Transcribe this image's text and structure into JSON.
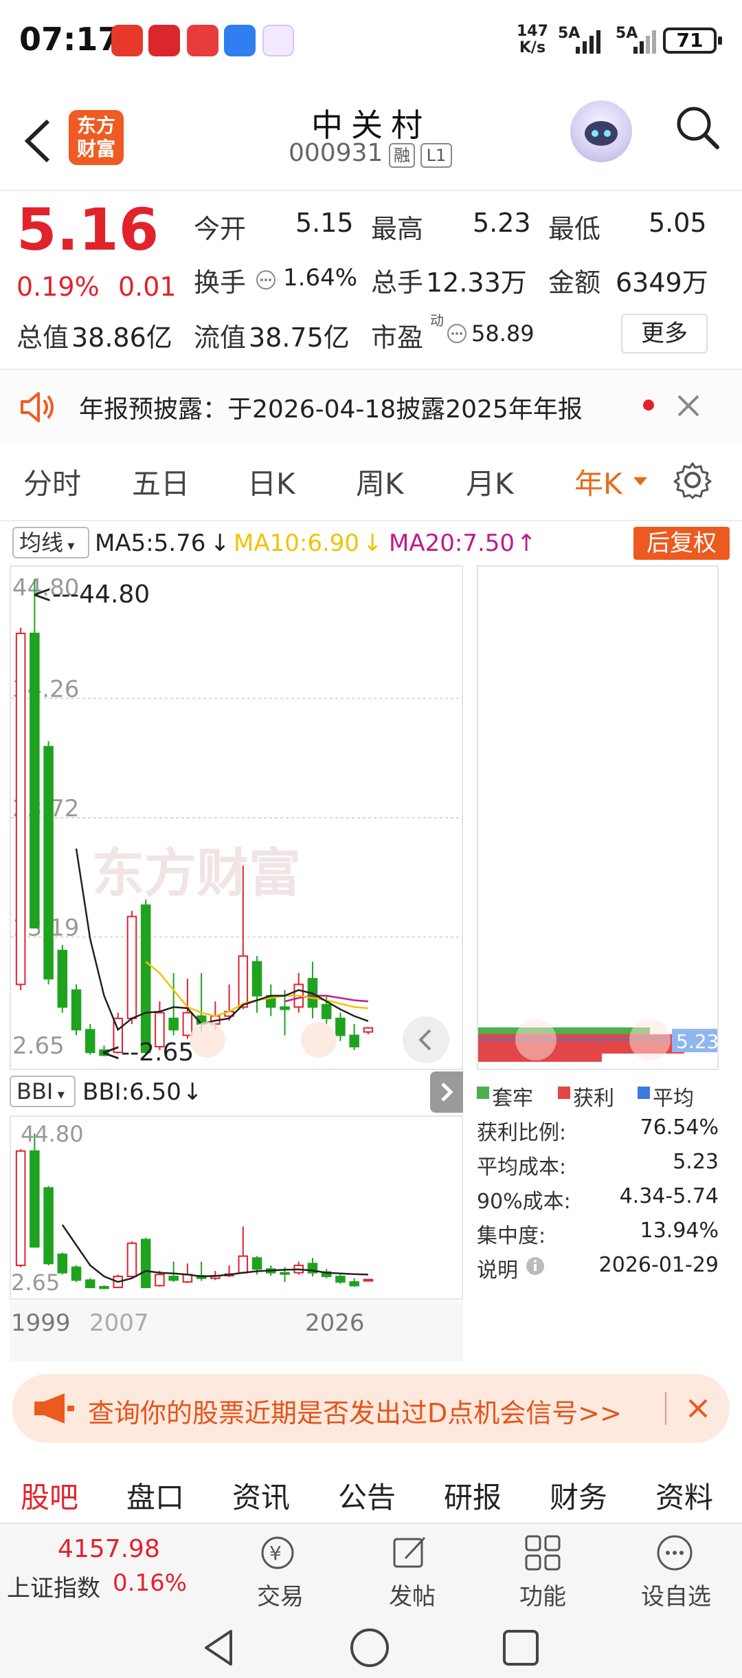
{
  "status_bar": {
    "time": "07:17",
    "net_speed_value": "147",
    "net_speed_unit": "K/s",
    "sig1": "5A",
    "sig2": "5A",
    "battery": "71"
  },
  "header": {
    "logo_text_line1": "东方",
    "logo_text_line2": "财富",
    "name": "中关村",
    "code": "000931",
    "tag1": "融",
    "tag2": "L1"
  },
  "quote": {
    "price": "5.16",
    "change_pct": "0.19%",
    "change": "0.01",
    "open_label": "今开",
    "open": "5.15",
    "high_label": "最高",
    "high": "5.23",
    "low_label": "最低",
    "low": "5.05",
    "turnover_label": "换手",
    "turnover": "1.64%",
    "volume_label": "总手",
    "volume": "12.33万",
    "amount_label": "金额",
    "amount": "6349万",
    "mktcap_label": "总值",
    "mktcap": "38.86亿",
    "float_label": "流值",
    "float": "38.75亿",
    "pe_label": "市盈",
    "pe_sup": "动",
    "pe": "58.89",
    "more": "更多"
  },
  "notice": {
    "text": "年报预披露：于2026-04-18披露2025年年报"
  },
  "period_tabs": [
    "分时",
    "五日",
    "日K",
    "周K",
    "月K",
    "年K"
  ],
  "indicators": {
    "ma_selector": "均线",
    "ma5": "MA5:5.76",
    "ma10": "MA10:6.90",
    "ma20": "MA20:7.50",
    "adjust": "后复权",
    "bbi_selector": "BBI",
    "bbi": "BBI:6.50"
  },
  "chart_axis": {
    "y_ticks": [
      "44.80",
      "34.26",
      "23.72",
      "13.19",
      "2.65"
    ],
    "max_marker": "<---44.80",
    "min_marker": "<--2.65",
    "bbi_top": "44.80",
    "bbi_bottom": "2.65",
    "x_ticks": [
      "1999",
      "2007",
      "2026"
    ],
    "watermark": "东方财富"
  },
  "chip": {
    "price_tag": "5.23",
    "legend": [
      "套牢",
      "获利",
      "平均"
    ],
    "stats": [
      {
        "label": "获利比例:",
        "value": "76.54%"
      },
      {
        "label": "平均成本:",
        "value": "5.23"
      },
      {
        "label": "90%成本:",
        "value": "4.34-5.74"
      },
      {
        "label": "集中度:",
        "value": "13.94%"
      },
      {
        "label": "说明",
        "value": "2026-01-29"
      }
    ]
  },
  "chart_data": {
    "type": "candlestick",
    "y_range": [
      2.65,
      44.8
    ],
    "candles": [
      {
        "o": 9.0,
        "c": 40.0,
        "h": 40.5,
        "l": 8.5
      },
      {
        "o": 40.0,
        "c": 14.0,
        "h": 44.8,
        "l": 14.0
      },
      {
        "o": 30.0,
        "c": 9.5,
        "h": 30.5,
        "l": 9.0
      },
      {
        "o": 12.0,
        "c": 7.0,
        "h": 12.5,
        "l": 6.5
      },
      {
        "o": 8.5,
        "c": 5.0,
        "h": 9.0,
        "l": 4.5
      },
      {
        "o": 5.0,
        "c": 3.0,
        "h": 5.5,
        "l": 2.8
      },
      {
        "o": 3.2,
        "c": 2.75,
        "h": 3.6,
        "l": 2.65
      },
      {
        "o": 3.0,
        "c": 6.0,
        "h": 6.5,
        "l": 2.9
      },
      {
        "o": 6.0,
        "c": 15.0,
        "h": 15.5,
        "l": 5.5
      },
      {
        "o": 16.0,
        "c": 3.0,
        "h": 16.5,
        "l": 2.9
      },
      {
        "o": 3.5,
        "c": 6.5,
        "h": 7.5,
        "l": 3.2
      },
      {
        "o": 6.0,
        "c": 5.0,
        "h": 10.0,
        "l": 4.5
      },
      {
        "o": 4.5,
        "c": 6.5,
        "h": 9.5,
        "l": 4.2
      },
      {
        "o": 6.2,
        "c": 5.5,
        "h": 10.0,
        "l": 4.8
      },
      {
        "o": 5.5,
        "c": 6.2,
        "h": 7.5,
        "l": 5.0
      },
      {
        "o": 6.2,
        "c": 6.6,
        "h": 9.0,
        "l": 5.8
      },
      {
        "o": 7.0,
        "c": 11.5,
        "h": 19.5,
        "l": 6.8
      },
      {
        "o": 11.0,
        "c": 8.0,
        "h": 11.5,
        "l": 6.5
      },
      {
        "o": 8.0,
        "c": 7.0,
        "h": 9.0,
        "l": 6.2
      },
      {
        "o": 7.0,
        "c": 6.8,
        "h": 8.5,
        "l": 4.5
      },
      {
        "o": 7.0,
        "c": 9.0,
        "h": 10.0,
        "l": 6.5
      },
      {
        "o": 9.5,
        "c": 7.0,
        "h": 11.0,
        "l": 6.0
      },
      {
        "o": 7.2,
        "c": 6.0,
        "h": 8.0,
        "l": 5.5
      },
      {
        "o": 6.0,
        "c": 4.5,
        "h": 6.5,
        "l": 4.0
      },
      {
        "o": 4.5,
        "c": 3.5,
        "h": 5.5,
        "l": 3.2
      },
      {
        "o": 4.8,
        "c": 5.16,
        "h": 5.23,
        "l": 4.6
      }
    ],
    "bbi": [
      null,
      null,
      null,
      20.0,
      14.5,
      9.0,
      6.0,
      4.5,
      5.5,
      7.5,
      7.0,
      6.8,
      6.5,
      6.0,
      6.1,
      6.5,
      7.0,
      7.4,
      7.6,
      7.8,
      7.9,
      7.6,
      7.0,
      6.8,
      6.6,
      6.5
    ],
    "ma5": [
      null,
      null,
      null,
      null,
      21.0,
      13.0,
      8.0,
      5.0,
      6.0,
      6.5,
      6.6,
      7.0,
      6.9,
      5.5,
      5.8,
      6.0,
      7.2,
      7.6,
      8.0,
      8.0,
      8.5,
      8.2,
      7.5,
      6.8,
      6.2,
      5.76
    ],
    "ma10": [
      null,
      null,
      null,
      null,
      null,
      null,
      null,
      null,
      null,
      11.0,
      10.0,
      8.5,
      7.0,
      6.5,
      6.2,
      6.6,
      7.3,
      7.6,
      7.8,
      8.0,
      8.0,
      7.8,
      7.6,
      7.3,
      7.0,
      6.9
    ],
    "ma20": [
      null,
      null,
      null,
      null,
      null,
      null,
      null,
      null,
      null,
      null,
      null,
      null,
      null,
      null,
      null,
      null,
      null,
      null,
      null,
      7.5,
      7.8,
      8.0,
      8.0,
      7.8,
      7.6,
      7.5
    ]
  },
  "promo": {
    "text": "查询你的股票近期是否发出过D点机会信号>>"
  },
  "bottom_tabs": [
    "股吧",
    "盘口",
    "资讯",
    "公告",
    "研报",
    "财务",
    "资料"
  ],
  "footer": {
    "index_value": "4157.98",
    "index_name": "上证指数",
    "index_change": "0.16%",
    "buttons": [
      "交易",
      "发帖",
      "功能",
      "设自选"
    ]
  },
  "colors": {
    "up": "#e2222b",
    "down": "#1fa31f",
    "accent": "#ec5a1f",
    "ma5": "#222222",
    "ma10": "#f2c200",
    "ma20": "#c0198a"
  }
}
